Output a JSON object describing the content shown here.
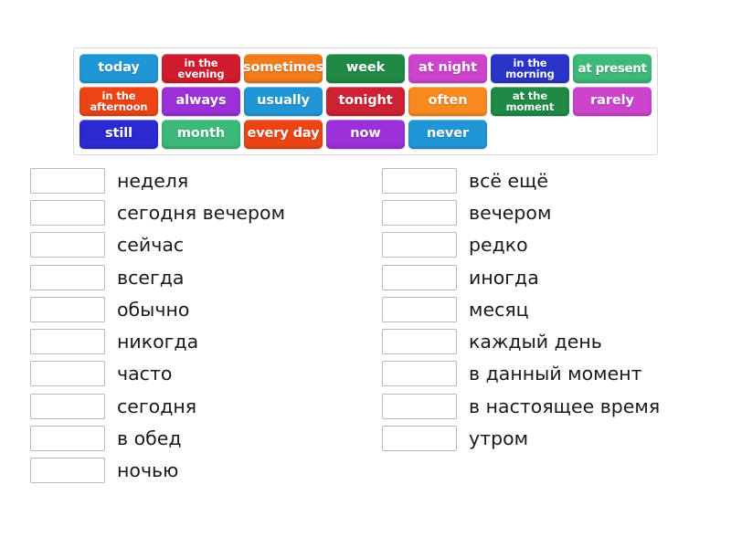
{
  "exercise": {
    "type": "drag-and-drop-matching",
    "word_bank": {
      "rows": [
        [
          {
            "label": "today",
            "color": "#2196d6",
            "lines": 1
          },
          {
            "label": "in the evening",
            "color": "#d01c2e",
            "lines": 2
          },
          {
            "label": "sometimes",
            "color": "#f07c1b",
            "lines": 1
          },
          {
            "label": "week",
            "color": "#1e8a46",
            "lines": 1
          },
          {
            "label": "at night",
            "color": "#cc44cc",
            "lines": 1
          },
          {
            "label": "in the morning",
            "color": "#2a35c8",
            "lines": 2
          },
          {
            "label": "at present",
            "color": "#3cb878",
            "lines": 1
          }
        ],
        [
          {
            "label": "in the afternoon",
            "color": "#ec4415",
            "lines": 2
          },
          {
            "label": "always",
            "color": "#9b30d9",
            "lines": 1
          },
          {
            "label": "usually",
            "color": "#2196d6",
            "lines": 1
          },
          {
            "label": "tonight",
            "color": "#cc2233",
            "lines": 1
          },
          {
            "label": "often",
            "color": "#f7891f",
            "lines": 1
          },
          {
            "label": "at the moment",
            "color": "#1e8a46",
            "lines": 2
          },
          {
            "label": "rarely",
            "color": "#cc44cc",
            "lines": 1
          }
        ],
        [
          {
            "label": "still",
            "color": "#2a2ad0",
            "lines": 1
          },
          {
            "label": "month",
            "color": "#3cb878",
            "lines": 1
          },
          {
            "label": "every day",
            "color": "#ec4415",
            "lines": 1
          },
          {
            "label": "now",
            "color": "#9b30d9",
            "lines": 1
          },
          {
            "label": "never",
            "color": "#2196d6",
            "lines": 1
          }
        ]
      ]
    },
    "answers": {
      "left_column": [
        {
          "dropzone_value": "",
          "term": "неделя"
        },
        {
          "dropzone_value": "",
          "term": "сегодня вечером"
        },
        {
          "dropzone_value": "",
          "term": "сейчас"
        },
        {
          "dropzone_value": "",
          "term": "всегда"
        },
        {
          "dropzone_value": "",
          "term": "обычно"
        },
        {
          "dropzone_value": "",
          "term": "никогда"
        },
        {
          "dropzone_value": "",
          "term": "часто"
        },
        {
          "dropzone_value": "",
          "term": "сегодня"
        },
        {
          "dropzone_value": "",
          "term": "в обед"
        },
        {
          "dropzone_value": "",
          "term": "ночью"
        }
      ],
      "right_column": [
        {
          "dropzone_value": "",
          "term": "всё ещё"
        },
        {
          "dropzone_value": "",
          "term": "вечером"
        },
        {
          "dropzone_value": "",
          "term": "редко"
        },
        {
          "dropzone_value": "",
          "term": "иногда"
        },
        {
          "dropzone_value": "",
          "term": "месяц"
        },
        {
          "dropzone_value": "",
          "term": "каждый день"
        },
        {
          "dropzone_value": "",
          "term": "в данный момент"
        },
        {
          "dropzone_value": "",
          "term": "в настоящее время"
        },
        {
          "dropzone_value": "",
          "term": "утром"
        }
      ]
    }
  }
}
